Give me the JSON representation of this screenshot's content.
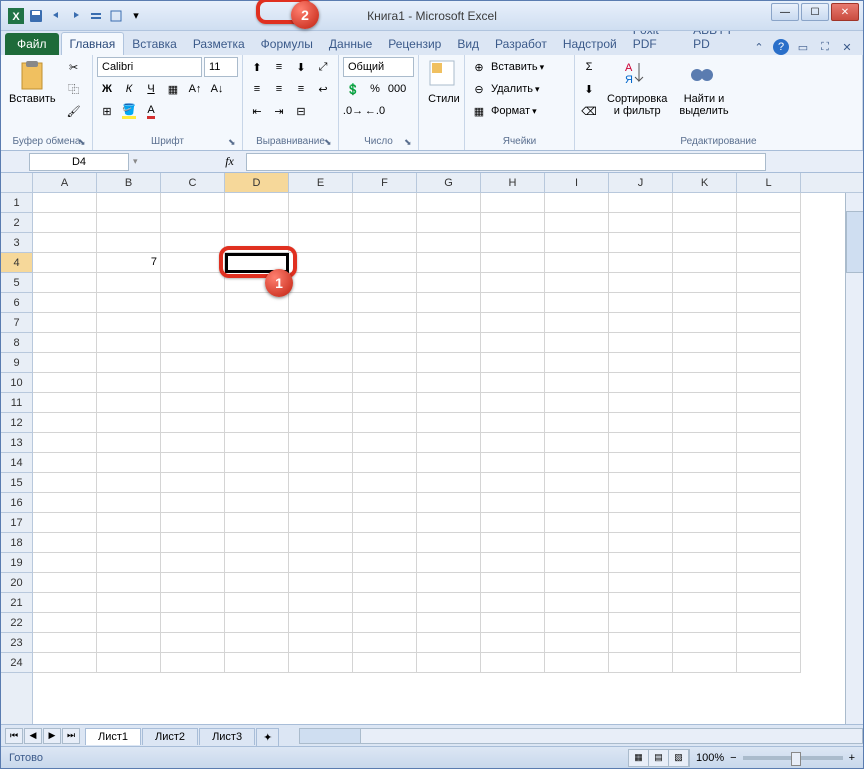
{
  "title": "Книга1 - Microsoft Excel",
  "tabs": {
    "file": "Файл",
    "home": "Главная",
    "insert": "Вставка",
    "layout": "Разметка",
    "formulas": "Формулы",
    "data": "Данные",
    "review": "Рецензир",
    "view": "Вид",
    "dev": "Разработ",
    "addins": "Надстрой",
    "foxit": "Foxit PDF",
    "abbyy": "ABBYY PD"
  },
  "ribbon": {
    "clipboard": {
      "paste": "Вставить",
      "label": "Буфер обмена"
    },
    "font": {
      "name": "Calibri",
      "size": "11",
      "label": "Шрифт",
      "bold": "Ж",
      "italic": "К",
      "underline": "Ч"
    },
    "align": {
      "label": "Выравнивание"
    },
    "number": {
      "format": "Общий",
      "label": "Число"
    },
    "styles": {
      "btn": "Стили"
    },
    "cells": {
      "insert": "Вставить",
      "delete": "Удалить",
      "format": "Формат",
      "label": "Ячейки"
    },
    "editing": {
      "sort": "Сортировка\nи фильтр",
      "find": "Найти и\nвыделить",
      "label": "Редактирование"
    }
  },
  "namebox": "D4",
  "fx": "fx",
  "columns": [
    "A",
    "B",
    "C",
    "D",
    "E",
    "F",
    "G",
    "H",
    "I",
    "J",
    "K",
    "L"
  ],
  "rows": [
    "1",
    "2",
    "3",
    "4",
    "5",
    "6",
    "7",
    "8",
    "9",
    "10",
    "11",
    "12",
    "13",
    "14",
    "15",
    "16",
    "17",
    "18",
    "19",
    "20",
    "21",
    "22",
    "23",
    "24"
  ],
  "cellB4": "7",
  "sheets": {
    "s1": "Лист1",
    "s2": "Лист2",
    "s3": "Лист3"
  },
  "status": "Готово",
  "zoom": "100%",
  "annotations": {
    "n1": "1",
    "n2": "2"
  }
}
